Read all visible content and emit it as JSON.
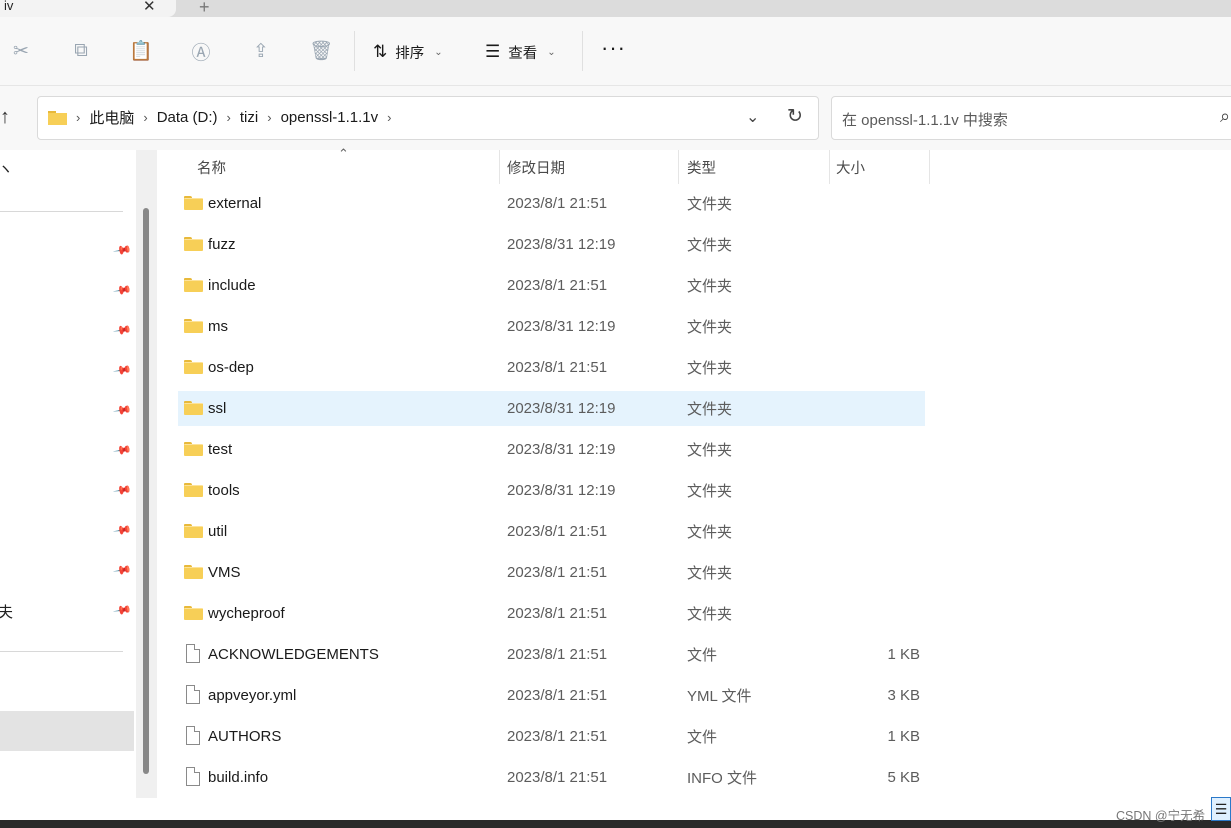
{
  "tab": {
    "title": "iv",
    "close": "✕",
    "add": "+"
  },
  "toolbar": {
    "icons": [
      "cut-icon",
      "copy-icon",
      "paste-icon",
      "rename-icon",
      "share-icon",
      "delete-icon"
    ],
    "sort_label": "排序",
    "view_label": "查看",
    "more": "···"
  },
  "address": {
    "crumbs": [
      "此电脑",
      "Data (D:)",
      "tizi",
      "openssl-1.1.1v"
    ]
  },
  "search": {
    "placeholder": "在 openssl-1.1.1v 中搜索"
  },
  "nav": {
    "fragment_1": "ヽ",
    "fragment_2": "夫"
  },
  "columns": {
    "name": "名称",
    "date": "修改日期",
    "type": "类型",
    "size": "大小"
  },
  "files": [
    {
      "name": "external",
      "date": "2023/8/1 21:51",
      "type": "文件夹",
      "size": "",
      "kind": "folder"
    },
    {
      "name": "fuzz",
      "date": "2023/8/31 12:19",
      "type": "文件夹",
      "size": "",
      "kind": "folder"
    },
    {
      "name": "include",
      "date": "2023/8/1 21:51",
      "type": "文件夹",
      "size": "",
      "kind": "folder"
    },
    {
      "name": "ms",
      "date": "2023/8/31 12:19",
      "type": "文件夹",
      "size": "",
      "kind": "folder"
    },
    {
      "name": "os-dep",
      "date": "2023/8/1 21:51",
      "type": "文件夹",
      "size": "",
      "kind": "folder"
    },
    {
      "name": "ssl",
      "date": "2023/8/31 12:19",
      "type": "文件夹",
      "size": "",
      "kind": "folder",
      "selected": true
    },
    {
      "name": "test",
      "date": "2023/8/31 12:19",
      "type": "文件夹",
      "size": "",
      "kind": "folder"
    },
    {
      "name": "tools",
      "date": "2023/8/31 12:19",
      "type": "文件夹",
      "size": "",
      "kind": "folder"
    },
    {
      "name": "util",
      "date": "2023/8/1 21:51",
      "type": "文件夹",
      "size": "",
      "kind": "folder"
    },
    {
      "name": "VMS",
      "date": "2023/8/1 21:51",
      "type": "文件夹",
      "size": "",
      "kind": "folder"
    },
    {
      "name": "wycheproof",
      "date": "2023/8/1 21:51",
      "type": "文件夹",
      "size": "",
      "kind": "folder"
    },
    {
      "name": "ACKNOWLEDGEMENTS",
      "date": "2023/8/1 21:51",
      "type": "文件",
      "size": "1 KB",
      "kind": "file"
    },
    {
      "name": "appveyor.yml",
      "date": "2023/8/1 21:51",
      "type": "YML 文件",
      "size": "3 KB",
      "kind": "file"
    },
    {
      "name": "AUTHORS",
      "date": "2023/8/1 21:51",
      "type": "文件",
      "size": "1 KB",
      "kind": "file"
    },
    {
      "name": "build.info",
      "date": "2023/8/1 21:51",
      "type": "INFO 文件",
      "size": "5 KB",
      "kind": "file"
    }
  ],
  "watermark": "CSDN @宁无希",
  "colors": {
    "selected_row": "#e5f3fd",
    "folder": "#f7cf57"
  }
}
